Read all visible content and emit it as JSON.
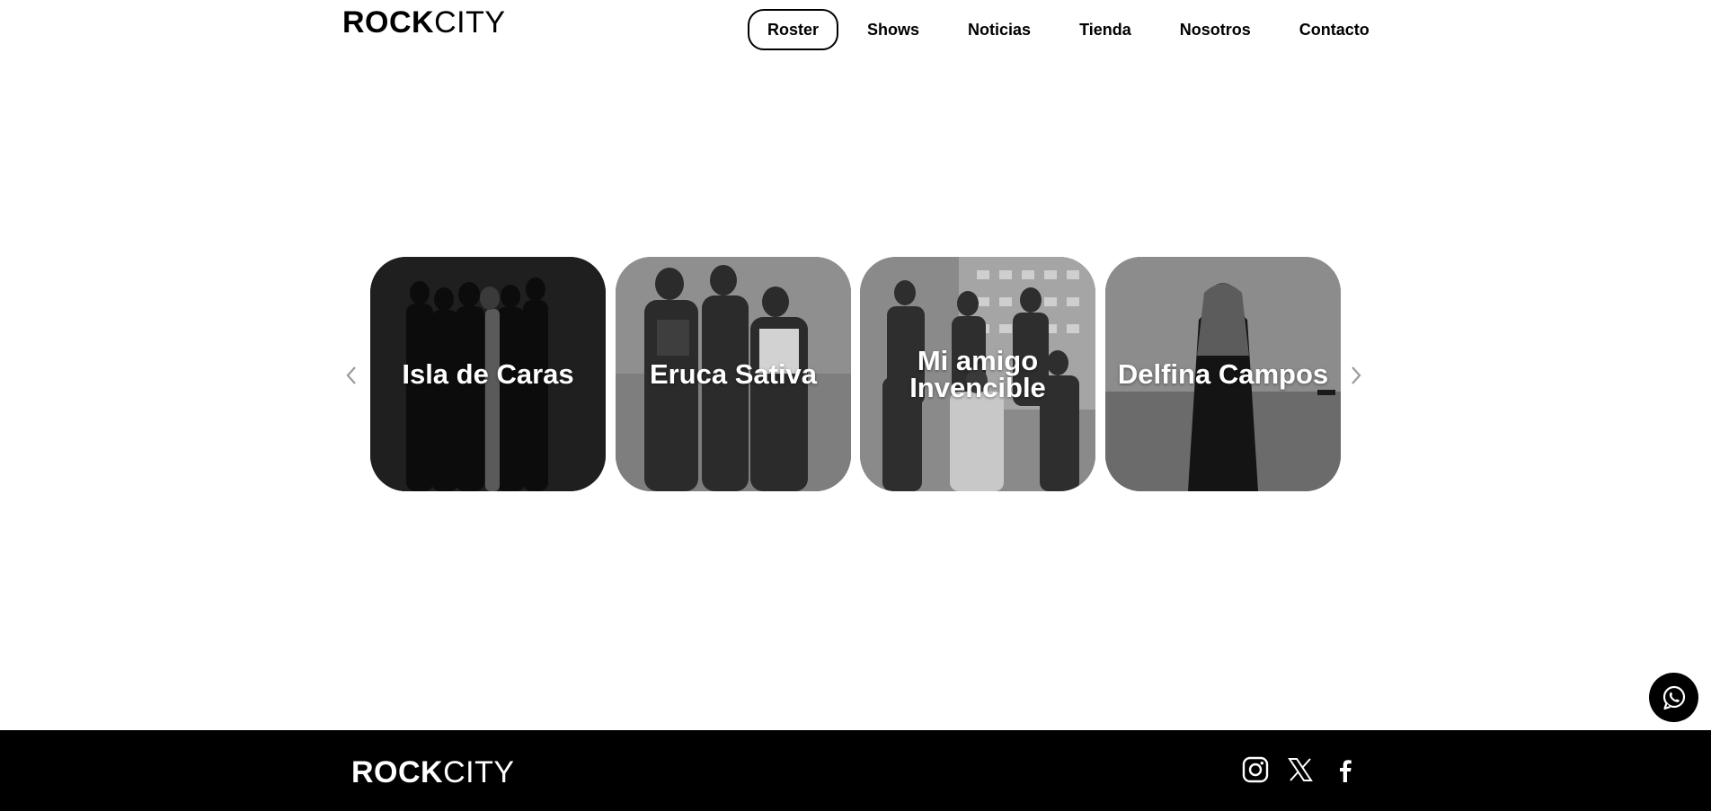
{
  "brand": {
    "logo_bold": "ROCK",
    "logo_light": "CITY"
  },
  "nav": {
    "items": [
      {
        "label": "Roster",
        "active": true
      },
      {
        "label": "Shows"
      },
      {
        "label": "Noticias"
      },
      {
        "label": "Tienda"
      },
      {
        "label": "Nosotros"
      },
      {
        "label": "Contacto"
      }
    ]
  },
  "roster": {
    "artists": [
      {
        "name": "Isla de Caras"
      },
      {
        "name": "Eruca Sativa"
      },
      {
        "name": "Mi amigo Invencible"
      },
      {
        "name": "Delfina Campos"
      }
    ],
    "prev_icon": "chevron-left-icon",
    "next_icon": "chevron-right-icon"
  },
  "floating": {
    "icon": "whatsapp-icon"
  },
  "footer": {
    "logo_bold": "ROCK",
    "logo_light": "CITY",
    "social": [
      {
        "icon": "instagram-icon"
      },
      {
        "icon": "x-icon"
      },
      {
        "icon": "facebook-icon"
      }
    ]
  },
  "colors": {
    "primary": "#000000",
    "background": "#ffffff",
    "arrow": "#9a9a9a"
  }
}
